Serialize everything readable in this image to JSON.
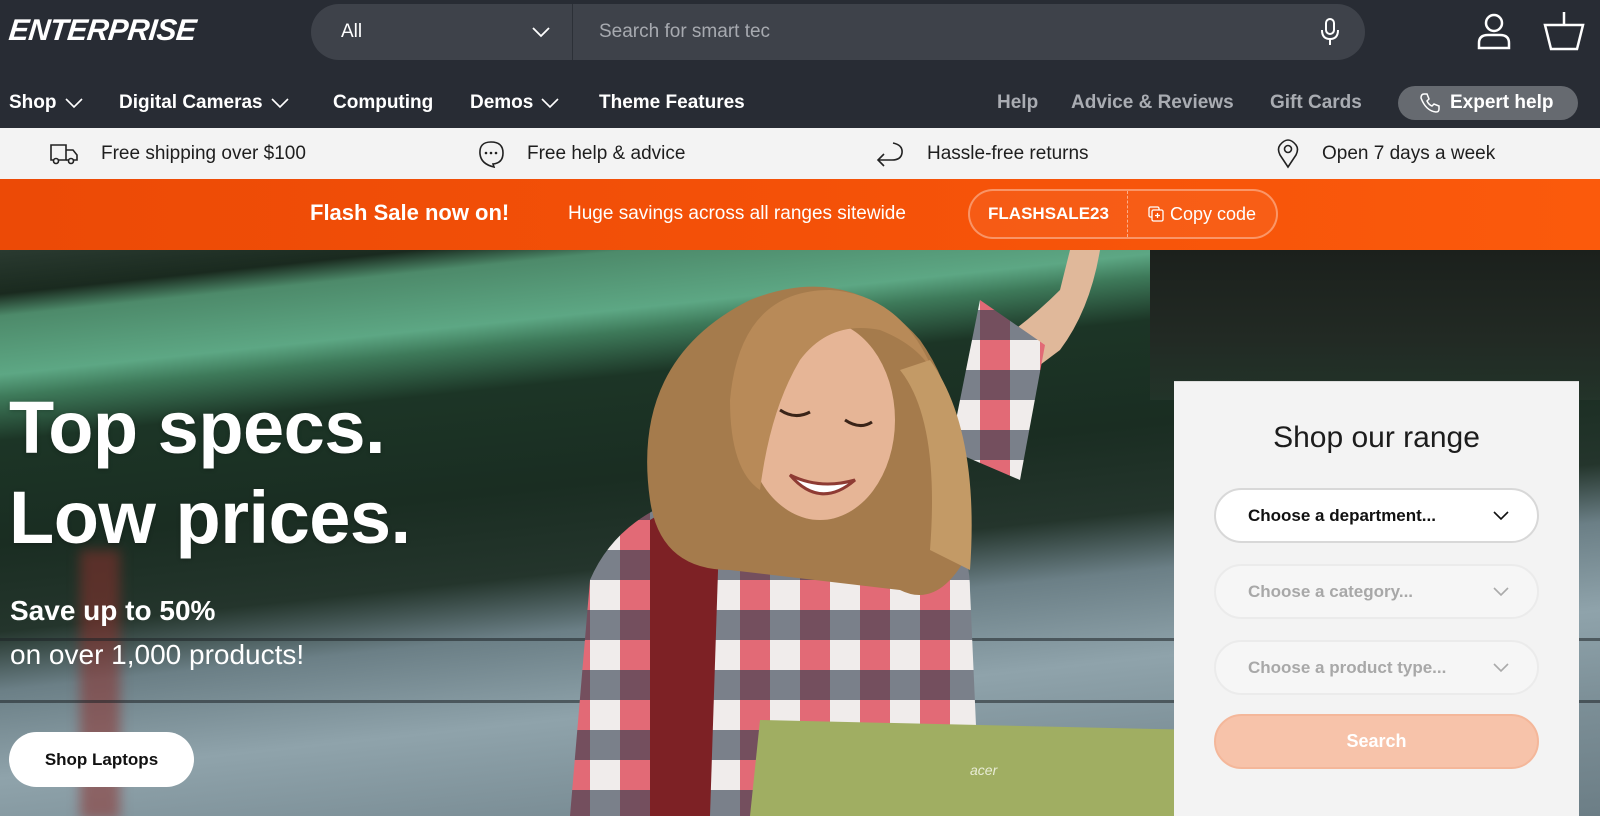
{
  "header": {
    "logo": "ENTERPRISE",
    "search": {
      "category_selected": "All",
      "placeholder": "Search for smart tec",
      "value": ""
    },
    "icons": {
      "mic": "microphone-icon",
      "account": "user-icon",
      "cart": "basket-icon"
    }
  },
  "nav": {
    "primary": [
      {
        "label": "Shop",
        "has_dropdown": true
      },
      {
        "label": "Digital Cameras",
        "has_dropdown": true
      },
      {
        "label": "Computing",
        "has_dropdown": false
      },
      {
        "label": "Demos",
        "has_dropdown": true
      },
      {
        "label": "Theme Features",
        "has_dropdown": false
      }
    ],
    "secondary": [
      {
        "label": "Help"
      },
      {
        "label": "Advice & Reviews"
      },
      {
        "label": "Gift Cards"
      }
    ],
    "expert_help": {
      "label": "Expert help",
      "icon": "phone-icon"
    }
  },
  "usp": [
    {
      "label": "Free shipping over $100",
      "icon": "truck-icon"
    },
    {
      "label": "Free help & advice",
      "icon": "chat-bubble-icon"
    },
    {
      "label": "Hassle-free returns",
      "icon": "return-arrow-icon"
    },
    {
      "label": "Open 7 days a week",
      "icon": "map-pin-icon"
    }
  ],
  "flash_sale": {
    "title": "Flash Sale now on!",
    "subtitle": "Huge savings across all ranges sitewide",
    "code": "FLASHSALE23",
    "copy_label": "Copy code",
    "color": "#f45108"
  },
  "hero": {
    "headline_line1": "Top specs.",
    "headline_line2": "Low prices.",
    "save_text": "Save up to 50%",
    "sub_text": "on over 1,000 products!",
    "cta_label": "Shop Laptops",
    "laptop_brand": "acer"
  },
  "shop_range": {
    "title": "Shop our range",
    "department_placeholder": "Choose a department...",
    "category_placeholder": "Choose a category...",
    "product_type_placeholder": "Choose a product type...",
    "search_label": "Search",
    "accent": "#f7c3aa"
  }
}
